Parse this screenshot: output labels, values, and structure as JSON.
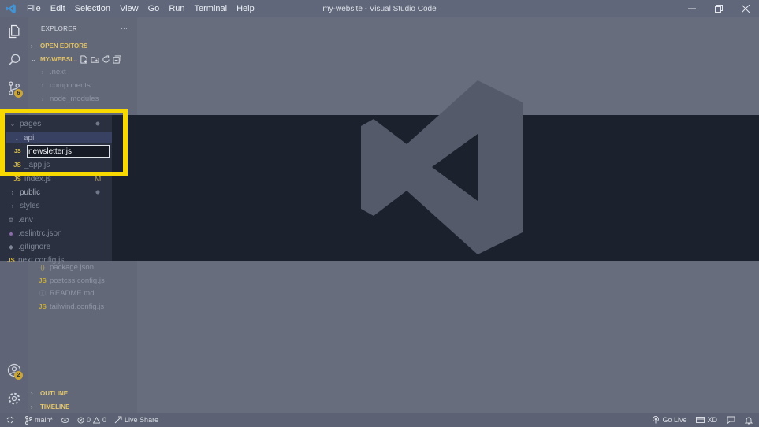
{
  "window": {
    "title": "my-website - Visual Studio Code"
  },
  "menu": [
    "File",
    "Edit",
    "Selection",
    "View",
    "Go",
    "Run",
    "Terminal",
    "Help"
  ],
  "activity": {
    "scm_badge": "6",
    "accounts_badge": "2"
  },
  "explorer": {
    "header": "EXPLORER",
    "more": "···",
    "open_editors": "OPEN EDITORS",
    "project": "MY-WEBSI...",
    "faded_items": [
      ".next",
      "components",
      "node_modules"
    ],
    "pages_folder": "pages",
    "api_folder": "api",
    "new_file_value": "newsletter.js",
    "app_file": "_app.js",
    "index_file": "index.js",
    "index_status": "M",
    "public_folder": "public",
    "styles_folder": "styles",
    "env_file": ".env",
    "eslint_file": ".eslintrc.json",
    "gitignore_file": ".gitignore",
    "next_config_file": "next.config.js",
    "lower_files": [
      "package.json",
      "postcss.config.js",
      "README.md",
      "tailwind.config.js"
    ],
    "outline": "OUTLINE",
    "timeline": "TIMELINE"
  },
  "status": {
    "branch": "main*",
    "errors": "0",
    "warnings": "0",
    "live_share": "Live Share",
    "go_live": "Go Live",
    "xd": "XD"
  },
  "colors": {
    "highlight": "#f7d800",
    "accent_js": "#e2c54c",
    "section_title": "#e1c36a"
  }
}
